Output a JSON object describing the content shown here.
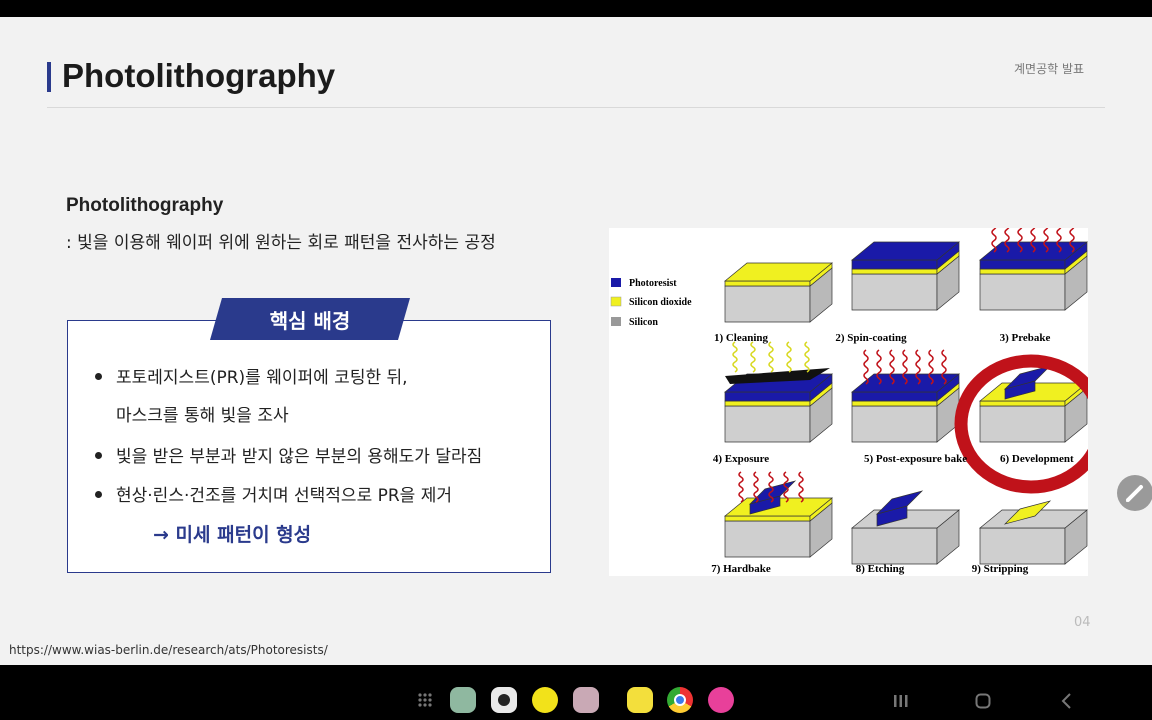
{
  "slide": {
    "title": "Photolithography",
    "brand": "계면공학 발표",
    "heading": "Photolithography",
    "definition": ": 빛을 이용해 웨이퍼 위에 원하는 회로 패턴을 전사하는 공정",
    "box_title": "핵심 배경",
    "bullets": [
      "포토레지스트(PR)를 웨이퍼에 코팅한 뒤,",
      "빛을 받은 부분과 받지 않은 부분의 용해도가 달라짐",
      "현상·린스·건조를 거치며 선택적으로 PR을 제거"
    ],
    "bullet1_cont": "마스크를 통해 빛을 조사",
    "result": "→ 미세 패턴이 형성",
    "page_number": "04",
    "source_url": "https://www.wias-berlin.de/research/ats/Photoresists/"
  },
  "figure": {
    "legend": [
      "Photoresist",
      "Silicon dioxide",
      "Silicon"
    ],
    "steps": [
      "1) Cleaning",
      "2) Spin-coating",
      "3) Prebake",
      "4) Exposure",
      "5) Post-exposure bake",
      "6) Development",
      "7) Hardbake",
      "8) Etching",
      "9) Stripping"
    ],
    "colors": {
      "photoresist": "#1a1aa8",
      "oxide": "#f0f020",
      "silicon": "#b0b0b0",
      "highlight": "#c0121a"
    }
  },
  "navbar": {
    "apps": [
      "apps-grid-icon",
      "folder-icon",
      "camera-icon",
      "tasks-icon",
      "gallery-icon",
      "notes-icon",
      "chrome-icon",
      "flower-icon"
    ],
    "buttons": [
      "recents-button",
      "home-button",
      "back-button"
    ]
  }
}
